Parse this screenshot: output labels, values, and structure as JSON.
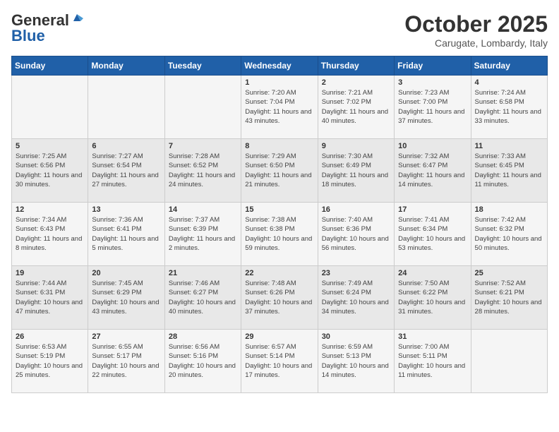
{
  "header": {
    "logo_line1": "General",
    "logo_line2": "Blue",
    "month": "October 2025",
    "location": "Carugate, Lombardy, Italy"
  },
  "days_of_week": [
    "Sunday",
    "Monday",
    "Tuesday",
    "Wednesday",
    "Thursday",
    "Friday",
    "Saturday"
  ],
  "weeks": [
    [
      {
        "day": "",
        "info": ""
      },
      {
        "day": "",
        "info": ""
      },
      {
        "day": "",
        "info": ""
      },
      {
        "day": "1",
        "info": "Sunrise: 7:20 AM\nSunset: 7:04 PM\nDaylight: 11 hours\nand 43 minutes."
      },
      {
        "day": "2",
        "info": "Sunrise: 7:21 AM\nSunset: 7:02 PM\nDaylight: 11 hours\nand 40 minutes."
      },
      {
        "day": "3",
        "info": "Sunrise: 7:23 AM\nSunset: 7:00 PM\nDaylight: 11 hours\nand 37 minutes."
      },
      {
        "day": "4",
        "info": "Sunrise: 7:24 AM\nSunset: 6:58 PM\nDaylight: 11 hours\nand 33 minutes."
      }
    ],
    [
      {
        "day": "5",
        "info": "Sunrise: 7:25 AM\nSunset: 6:56 PM\nDaylight: 11 hours\nand 30 minutes."
      },
      {
        "day": "6",
        "info": "Sunrise: 7:27 AM\nSunset: 6:54 PM\nDaylight: 11 hours\nand 27 minutes."
      },
      {
        "day": "7",
        "info": "Sunrise: 7:28 AM\nSunset: 6:52 PM\nDaylight: 11 hours\nand 24 minutes."
      },
      {
        "day": "8",
        "info": "Sunrise: 7:29 AM\nSunset: 6:50 PM\nDaylight: 11 hours\nand 21 minutes."
      },
      {
        "day": "9",
        "info": "Sunrise: 7:30 AM\nSunset: 6:49 PM\nDaylight: 11 hours\nand 18 minutes."
      },
      {
        "day": "10",
        "info": "Sunrise: 7:32 AM\nSunset: 6:47 PM\nDaylight: 11 hours\nand 14 minutes."
      },
      {
        "day": "11",
        "info": "Sunrise: 7:33 AM\nSunset: 6:45 PM\nDaylight: 11 hours\nand 11 minutes."
      }
    ],
    [
      {
        "day": "12",
        "info": "Sunrise: 7:34 AM\nSunset: 6:43 PM\nDaylight: 11 hours\nand 8 minutes."
      },
      {
        "day": "13",
        "info": "Sunrise: 7:36 AM\nSunset: 6:41 PM\nDaylight: 11 hours\nand 5 minutes."
      },
      {
        "day": "14",
        "info": "Sunrise: 7:37 AM\nSunset: 6:39 PM\nDaylight: 11 hours\nand 2 minutes."
      },
      {
        "day": "15",
        "info": "Sunrise: 7:38 AM\nSunset: 6:38 PM\nDaylight: 10 hours\nand 59 minutes."
      },
      {
        "day": "16",
        "info": "Sunrise: 7:40 AM\nSunset: 6:36 PM\nDaylight: 10 hours\nand 56 minutes."
      },
      {
        "day": "17",
        "info": "Sunrise: 7:41 AM\nSunset: 6:34 PM\nDaylight: 10 hours\nand 53 minutes."
      },
      {
        "day": "18",
        "info": "Sunrise: 7:42 AM\nSunset: 6:32 PM\nDaylight: 10 hours\nand 50 minutes."
      }
    ],
    [
      {
        "day": "19",
        "info": "Sunrise: 7:44 AM\nSunset: 6:31 PM\nDaylight: 10 hours\nand 47 minutes."
      },
      {
        "day": "20",
        "info": "Sunrise: 7:45 AM\nSunset: 6:29 PM\nDaylight: 10 hours\nand 43 minutes."
      },
      {
        "day": "21",
        "info": "Sunrise: 7:46 AM\nSunset: 6:27 PM\nDaylight: 10 hours\nand 40 minutes."
      },
      {
        "day": "22",
        "info": "Sunrise: 7:48 AM\nSunset: 6:26 PM\nDaylight: 10 hours\nand 37 minutes."
      },
      {
        "day": "23",
        "info": "Sunrise: 7:49 AM\nSunset: 6:24 PM\nDaylight: 10 hours\nand 34 minutes."
      },
      {
        "day": "24",
        "info": "Sunrise: 7:50 AM\nSunset: 6:22 PM\nDaylight: 10 hours\nand 31 minutes."
      },
      {
        "day": "25",
        "info": "Sunrise: 7:52 AM\nSunset: 6:21 PM\nDaylight: 10 hours\nand 28 minutes."
      }
    ],
    [
      {
        "day": "26",
        "info": "Sunrise: 6:53 AM\nSunset: 5:19 PM\nDaylight: 10 hours\nand 25 minutes."
      },
      {
        "day": "27",
        "info": "Sunrise: 6:55 AM\nSunset: 5:17 PM\nDaylight: 10 hours\nand 22 minutes."
      },
      {
        "day": "28",
        "info": "Sunrise: 6:56 AM\nSunset: 5:16 PM\nDaylight: 10 hours\nand 20 minutes."
      },
      {
        "day": "29",
        "info": "Sunrise: 6:57 AM\nSunset: 5:14 PM\nDaylight: 10 hours\nand 17 minutes."
      },
      {
        "day": "30",
        "info": "Sunrise: 6:59 AM\nSunset: 5:13 PM\nDaylight: 10 hours\nand 14 minutes."
      },
      {
        "day": "31",
        "info": "Sunrise: 7:00 AM\nSunset: 5:11 PM\nDaylight: 10 hours\nand 11 minutes."
      },
      {
        "day": "",
        "info": ""
      }
    ]
  ]
}
